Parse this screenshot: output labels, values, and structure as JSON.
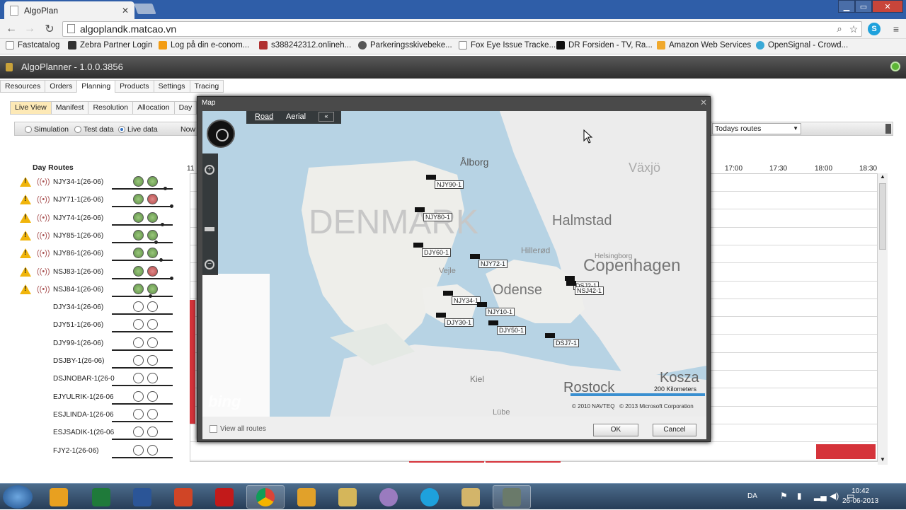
{
  "browser": {
    "tab_title": "AlgoPlan",
    "url": "algoplandk.matcao.vn",
    "bookmarks": [
      "Fastcatalog",
      "Zebra Partner Login",
      "Log på din e-conom...",
      "s388242312.onlineh...",
      "Parkeringsskivebeke...",
      "Fox Eye Issue Tracke...",
      "DR Forsiden - TV, Ra...",
      "Amazon Web Services",
      "OpenSignal - Crowd..."
    ]
  },
  "app": {
    "title": "AlgoPlanner - 1.0.0.3856",
    "main_tabs": [
      "Resources",
      "Orders",
      "Planning",
      "Products",
      "Settings",
      "Tracing"
    ],
    "active_main_tab": "Planning",
    "sub_tabs": [
      "Live View",
      "Manifest",
      "Resolution",
      "Allocation",
      "Day"
    ],
    "active_sub_tab": "Live View",
    "data_modes": [
      "Simulation",
      "Test data",
      "Live data"
    ],
    "selected_mode": "Live data",
    "now_label": "Now",
    "routes_filter": "Todays routes",
    "day_routes_title": "Day Routes",
    "timeline_start": "11",
    "timeline": [
      "17:00",
      "17:30",
      "18:00",
      "18:30"
    ]
  },
  "routes": [
    {
      "name": "NJY34-1(26-06)",
      "warn": true,
      "c1": "green",
      "c2": "green",
      "progress": 0.85
    },
    {
      "name": "NJY71-1(26-06)",
      "warn": true,
      "c1": "green",
      "c2": "red",
      "progress": 0.95
    },
    {
      "name": "NJY74-1(26-06)",
      "warn": true,
      "c1": "green",
      "c2": "green",
      "progress": 0.8
    },
    {
      "name": "NJY85-1(26-06)",
      "warn": true,
      "c1": "green",
      "c2": "green",
      "progress": 0.7
    },
    {
      "name": "NJY86-1(26-06)",
      "warn": true,
      "c1": "green",
      "c2": "green",
      "progress": 0.78
    },
    {
      "name": "NSJ83-1(26-06)",
      "warn": true,
      "c1": "green",
      "c2": "red",
      "progress": 0.95
    },
    {
      "name": "NSJ84-1(26-06)",
      "warn": true,
      "c1": "green",
      "c2": "green",
      "progress": 0.6
    },
    {
      "name": "DJY34-1(26-06)",
      "warn": false,
      "c1": "white",
      "c2": "white",
      "progress": 0
    },
    {
      "name": "DJY51-1(26-06)",
      "warn": false,
      "c1": "white",
      "c2": "white",
      "progress": 0
    },
    {
      "name": "DJY99-1(26-06)",
      "warn": false,
      "c1": "white",
      "c2": "white",
      "progress": 0
    },
    {
      "name": "DSJBY-1(26-06)",
      "warn": false,
      "c1": "white",
      "c2": "white",
      "progress": 0
    },
    {
      "name": "DSJNOBAR-1(26-0",
      "warn": false,
      "c1": "white",
      "c2": "white",
      "progress": 0
    },
    {
      "name": "EJYULRIK-1(26-06",
      "warn": false,
      "c1": "white",
      "c2": "white",
      "progress": 0
    },
    {
      "name": "ESJLINDA-1(26-06",
      "warn": false,
      "c1": "white",
      "c2": "white",
      "progress": 0
    },
    {
      "name": "ESJSADIK-1(26-06",
      "warn": false,
      "c1": "white",
      "c2": "white",
      "progress": 0
    },
    {
      "name": "FJY2-1(26-06)",
      "warn": false,
      "c1": "white",
      "c2": "white",
      "progress": 0
    }
  ],
  "map_dialog": {
    "title": "Map",
    "map_types": [
      "Road",
      "Aerial"
    ],
    "places": [
      "Ålborg",
      "DENMARK",
      "Halmstad",
      "Växjö",
      "Hillerød",
      "Helsingborg",
      "Copenhagen",
      "Vejle",
      "Odense",
      "Kiel",
      "Rostock",
      "Lübe",
      "Kosza"
    ],
    "vehicles": [
      "NJY90-1",
      "NJY80-1",
      "DJY60-1",
      "NJY72-1",
      "NJY34-1",
      "NJY10-1",
      "DJY30-1",
      "DJY50-1",
      "DSJ7-1",
      "DSJ2-1",
      "NSJ42-1"
    ],
    "scale": "200 Kilometers",
    "copyright": "© 2010 NAVTEQ   © 2013 Microsoft Corporation",
    "brand": "bing",
    "view_all_label": "View all routes",
    "ok_label": "OK",
    "cancel_label": "Cancel"
  },
  "taskbar": {
    "lang": "DA",
    "time": "10:42",
    "date": "26-06-2013"
  }
}
